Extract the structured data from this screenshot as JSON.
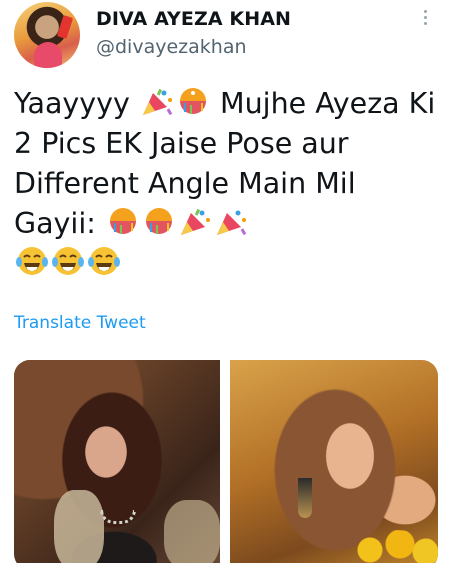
{
  "author": {
    "display_name": "DIVA AYEZA KHAN",
    "handle": "@divayezakhan"
  },
  "tweet": {
    "text_part1": "Yaayyyy ",
    "text_part2": " Mujhe Ayeza Ki 2 Pics EK Jaise Pose aur Different Angle Main Mil Gayii: ",
    "emoji_1": [
      "party-popper",
      "confetti-ball"
    ],
    "emoji_2": [
      "confetti-ball",
      "confetti-ball",
      "party-popper",
      "party-popper"
    ],
    "emoji_3": [
      "tears-of-joy",
      "tears-of-joy",
      "tears-of-joy"
    ]
  },
  "actions": {
    "translate_label": "Translate Tweet"
  },
  "media": {
    "count": 2,
    "photos": [
      "woman-portrait-brown-tones",
      "woman-portrait-golden-tones"
    ]
  },
  "colors": {
    "text": "#0f1419",
    "secondary_text": "#536471",
    "link": "#1d9bf0",
    "background": "#ffffff"
  }
}
